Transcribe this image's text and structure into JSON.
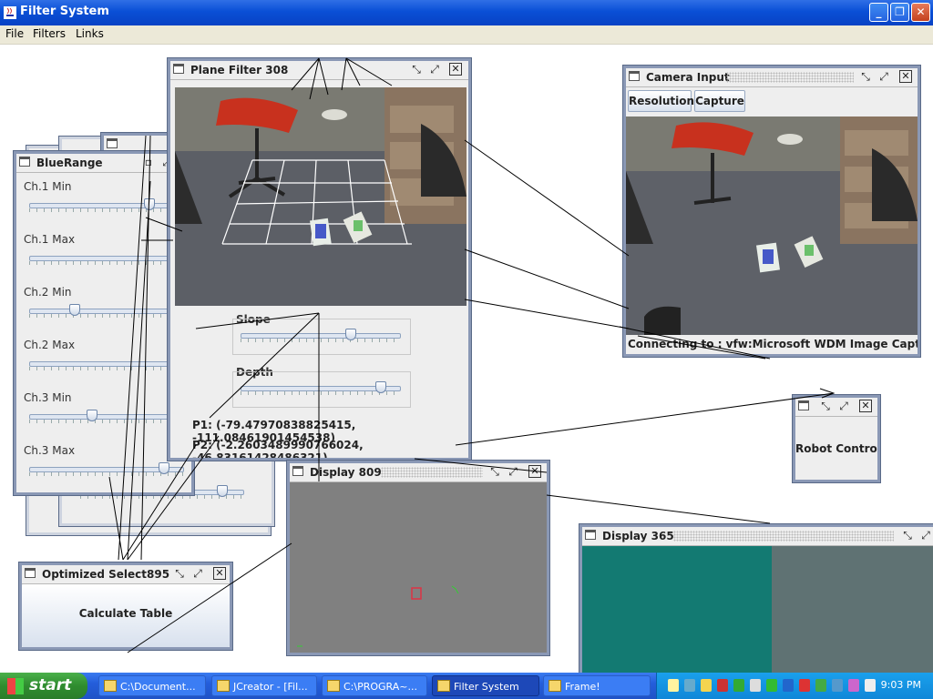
{
  "window": {
    "title": "Filter System"
  },
  "menu": [
    "File",
    "Filters",
    "Links"
  ],
  "frames": {
    "plane": {
      "title": "Plane Filter 308",
      "slope_label": "Slope",
      "depth_label": "Depth",
      "slope": 0.7,
      "depth": 0.9,
      "p1": "P1: (-79.47970838825415, -111.08461901454538)",
      "p2": "P2: (-2.2603489990766024, -46.83161428486321)"
    },
    "bluerange": {
      "title": "BlueRange",
      "sliders": [
        {
          "label": "Ch.1 Min",
          "value": 0.8
        },
        {
          "label": "Ch.1 Max",
          "value": 1.0
        },
        {
          "label": "Ch.2 Min",
          "value": 0.28
        },
        {
          "label": "Ch.2 Max",
          "value": 1.0
        },
        {
          "label": "Ch.3 Min",
          "value": 0.4
        },
        {
          "label": "Ch.3 Max",
          "value": 0.9
        }
      ]
    },
    "camera": {
      "title": "Camera Input",
      "resolution_label": "Resolution",
      "capture_label": "Capture",
      "status": "Connecting to : vfw:Microsoft WDM Image Capture (Wi..."
    },
    "robot": {
      "title": "",
      "label": "Robot Control ..."
    },
    "optimized": {
      "title": "Optimized Select895",
      "button": "Calculate Table"
    },
    "display809": {
      "title": "Display 809"
    },
    "display365": {
      "title": "Display 365"
    }
  },
  "taskbar": {
    "start": "start",
    "items": [
      "C:\\Document...",
      "JCreator - [Fil...",
      "C:\\PROGRA~...",
      "Filter System",
      "Frame!"
    ],
    "active": 3,
    "clock": "9:03 PM"
  },
  "colors": {
    "title_blue": "#0a4fd6",
    "frame_border": "#8a98b5",
    "display_gray": "#808080",
    "display365_teal": "#137a72",
    "display365_slate": "#5f7273"
  }
}
